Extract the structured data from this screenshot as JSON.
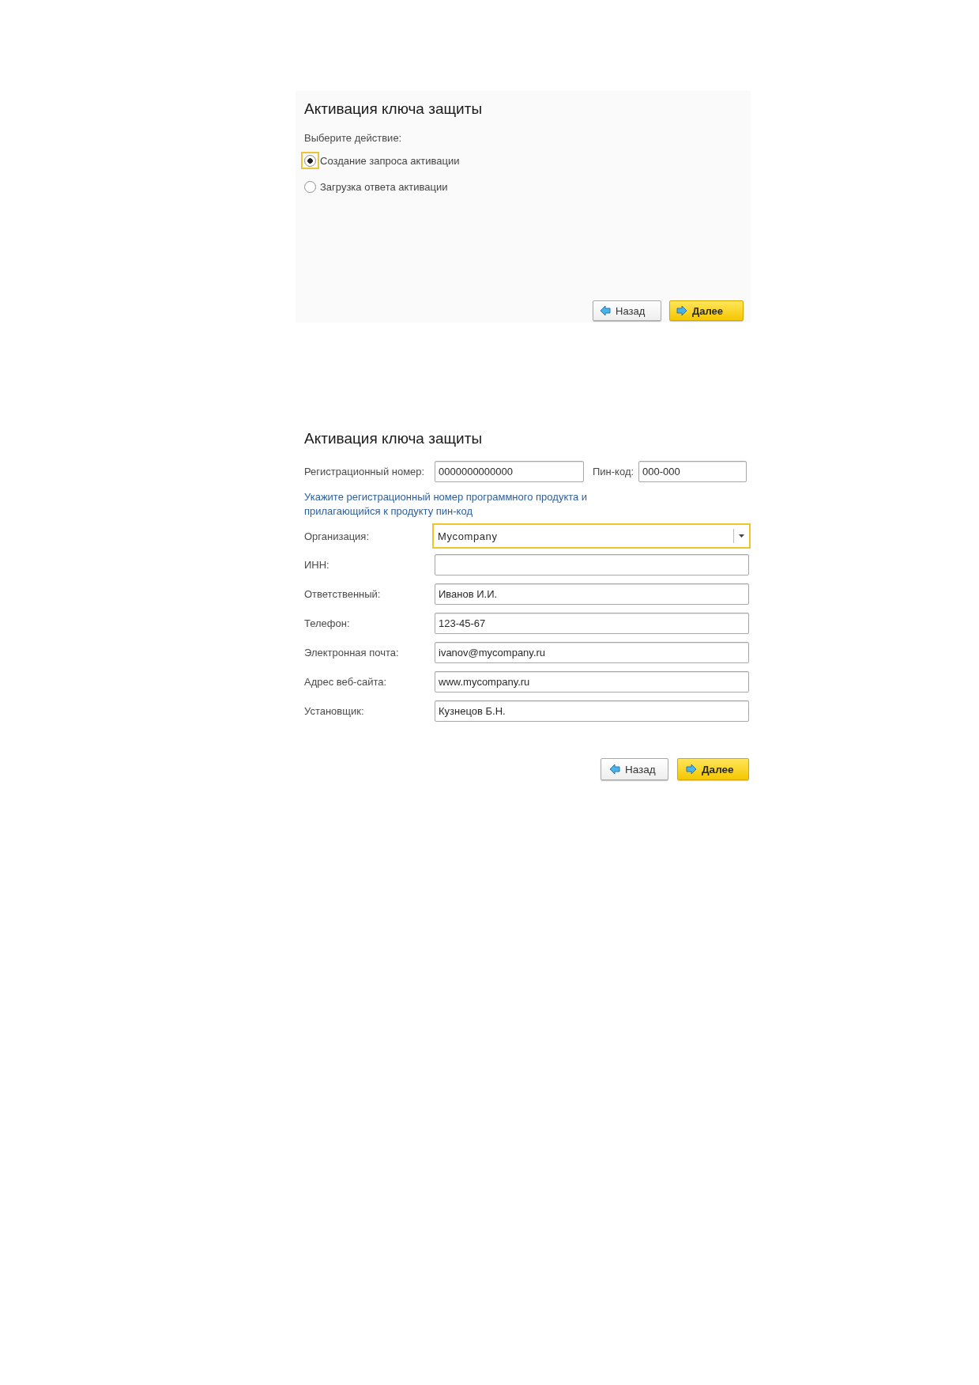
{
  "panels": [
    {
      "kind": "choice",
      "title": "Активация ключа защиты",
      "prompt": "Выберите действие:",
      "options": [
        {
          "label": "Создание запроса активации",
          "selected": true,
          "focused": true
        },
        {
          "label": "Загрузка ответа активации",
          "selected": false,
          "focused": false
        }
      ],
      "buttons": [
        {
          "kind": "back",
          "label": "Назад"
        },
        {
          "kind": "next",
          "label": "Далее"
        }
      ]
    },
    {
      "kind": "form",
      "title": "Активация ключа защиты",
      "inline_fields": [
        {
          "label": "Регистрационный номер:",
          "value": "0000000000000"
        },
        {
          "label": "Пин-код:",
          "value": "000-000"
        }
      ],
      "hint": "Укажите регистрационный номер программного продукта и прилагающийся к продукту пин-код",
      "fields": [
        {
          "kind": "dropdown",
          "label": "Организация:",
          "value": "Mycompany",
          "focused": true
        },
        {
          "kind": "text",
          "label": "ИНН:",
          "focused": false
        },
        {
          "kind": "text",
          "label": "Ответственный:",
          "value": "Иванов И.И.",
          "focused": false
        },
        {
          "kind": "text",
          "label": "Телефон:",
          "value": "123-45-67",
          "focused": false
        },
        {
          "kind": "text",
          "label": "Электронная почта:",
          "value": "ivanov@mycompany.ru",
          "focused": false
        },
        {
          "kind": "text",
          "label": "Адрес веб-сайта:",
          "value": "www.mycompany.ru",
          "focused": false
        },
        {
          "kind": "text",
          "label": "Установщик:",
          "value": "Кузнецов Б.Н.",
          "focused": false
        }
      ],
      "buttons": [
        {
          "kind": "back",
          "label": "Назад"
        },
        {
          "kind": "next",
          "label": "Далее"
        }
      ]
    }
  ]
}
